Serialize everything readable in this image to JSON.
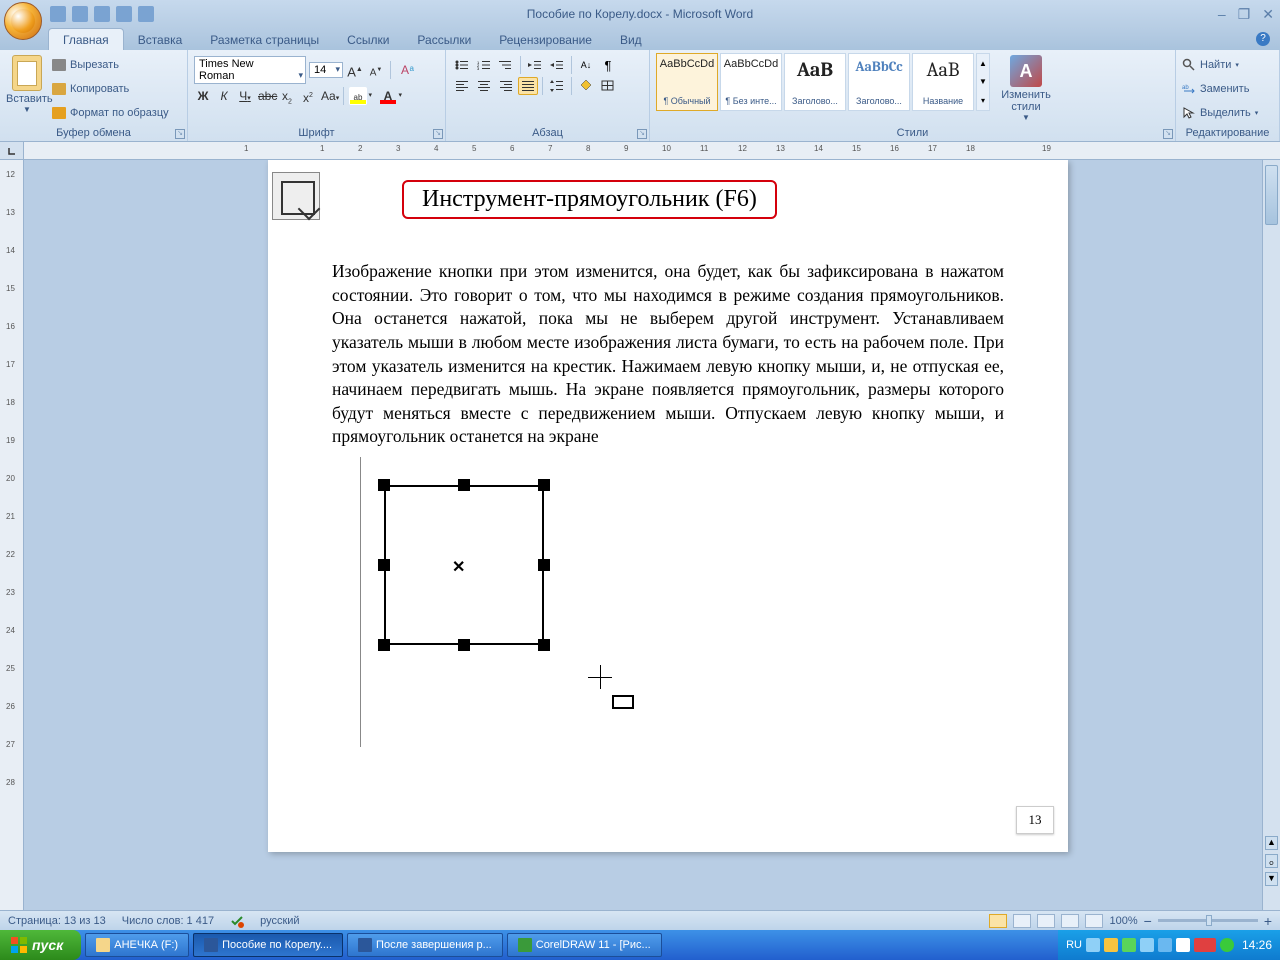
{
  "title": "Пособие по Корелу.docx - Microsoft Word",
  "tabs": [
    "Главная",
    "Вставка",
    "Разметка страницы",
    "Ссылки",
    "Рассылки",
    "Рецензирование",
    "Вид"
  ],
  "clipboard": {
    "paste": "Вставить",
    "cut": "Вырезать",
    "copy": "Копировать",
    "format": "Формат по образцу",
    "label": "Буфер обмена"
  },
  "font": {
    "name": "Times New Roman",
    "size": "14",
    "label": "Шрифт"
  },
  "para": {
    "label": "Абзац"
  },
  "styles": {
    "label": "Стили",
    "items": [
      {
        "preview": "AaBbCcDd",
        "name": "¶ Обычный"
      },
      {
        "preview": "AaBbCcDd",
        "name": "¶ Без инте..."
      },
      {
        "preview": "AaB",
        "name": "Заголово...",
        "big": true
      },
      {
        "preview": "AaBbCc",
        "name": "Заголово...",
        "blue": true
      },
      {
        "preview": "AaB",
        "name": "Название",
        "big": true
      }
    ],
    "change": "Изменить стили"
  },
  "editing": {
    "label": "Редактирование",
    "find": "Найти",
    "replace": "Заменить",
    "select": "Выделить"
  },
  "document": {
    "redbox": "Инструмент-прямоугольник (F6)",
    "text": "Изображение кнопки при этом изменится, она будет, как бы зафиксирована в нажатом состоянии. Это говорит о том, что мы находимся в режиме создания прямоугольников. Она останется нажатой, пока мы не выберем другой инструмент. Устанавливаем указатель мыши в любом месте изображения листа бумаги, то есть на рабочем поле. При этом указатель изменится на крестик. Нажимаем левую кнопку мыши, и, не отпуская ее, начинаем передвигать мышь. На экране появляется прямоугольник, размеры которого будут меняться вместе с передвижением мыши. Отпускаем левую кнопку мыши, и прямоугольник останется на экране",
    "pagenum": "13"
  },
  "status": {
    "page": "Страница: 13 из 13",
    "words": "Число слов: 1 417",
    "lang": "русский",
    "zoom": "100%"
  },
  "taskbar": {
    "start": "пуск",
    "items": [
      "АНЕЧКА (F:)",
      "Пособие по Корелу....",
      "После завершения р...",
      "CorelDRAW 11 - [Рис..."
    ],
    "lang": "RU",
    "time": "14:26"
  },
  "ruler_h": [
    "1",
    "",
    "1",
    "2",
    "3",
    "4",
    "5",
    "6",
    "7",
    "8",
    "9",
    "10",
    "11",
    "12",
    "13",
    "14",
    "15",
    "16",
    "17",
    "18",
    "",
    "19"
  ],
  "ruler_v": [
    "12",
    "13",
    "14",
    "15",
    "16",
    "17",
    "18",
    "19",
    "20",
    "21",
    "22",
    "23",
    "24",
    "25",
    "26",
    "27",
    "28"
  ]
}
